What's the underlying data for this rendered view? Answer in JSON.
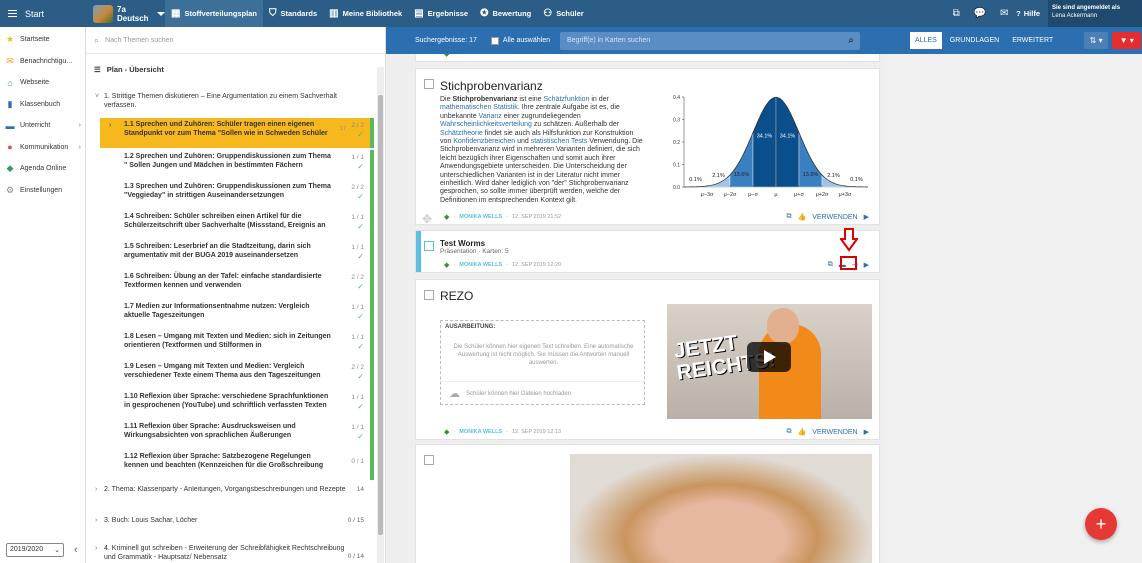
{
  "topbar": {
    "start_label": "Start",
    "class_name": "7a",
    "class_subject": "Deutsch",
    "nav": [
      {
        "label": "Stoffverteilungsplan",
        "icon": "calendar-icon",
        "active": true
      },
      {
        "label": "Standards",
        "icon": "shield-icon",
        "active": false
      },
      {
        "label": "Meine Bibliothek",
        "icon": "books-icon",
        "active": false
      },
      {
        "label": "Ergebnisse",
        "icon": "chart-icon",
        "active": false
      },
      {
        "label": "Bewertung",
        "icon": "rating-icon",
        "active": false
      },
      {
        "label": "Schüler",
        "icon": "students-icon",
        "active": false
      }
    ],
    "help_label": "Hilfe",
    "logged_in_label": "Sie sind angemeldet als",
    "user_name": "Lena Ackermann"
  },
  "sidebar": {
    "items": [
      {
        "label": "Startseite",
        "icon": "star-icon",
        "color": "#f6b81c"
      },
      {
        "label": "Benachrichtigu...",
        "icon": "mail-icon",
        "color": "#f0a030"
      },
      {
        "label": "Webseite",
        "icon": "home-icon",
        "color": "#2e9e5e"
      },
      {
        "label": "Klassenbuch",
        "icon": "book-icon",
        "color": "#2b6fb0"
      },
      {
        "label": "Unterricht",
        "icon": "folder-icon",
        "color": "#2b6fb0"
      },
      {
        "label": "Kommunikation",
        "icon": "chat-icon",
        "color": "#d9534f"
      },
      {
        "label": "Agenda Online",
        "icon": "agenda-icon",
        "color": "#2e9e5e"
      },
      {
        "label": "Einstellungen",
        "icon": "gear-icon",
        "color": "#888888"
      }
    ],
    "year": "2019/2020"
  },
  "themes": {
    "search_placeholder": "Nach Themen suchen",
    "plan_title": "Plan - Übersicht",
    "topic1": "1. Strittige Themen diskutieren – Eine Argumentation zu einem Sachverhalt verfassen.",
    "subs": [
      {
        "label": "1.1  Sprechen und Zuhören: Schüler tragen einen eigenen Standpunkt vor zum Thema \"Sollen wie in Schweden Schüler",
        "count": "2 / 2",
        "extra": "17"
      },
      {
        "label": "1.2  Sprechen und Zuhören: Gruppendiskussionen zum Thema \" Sollen Jungen und Mädchen in bestimmten Fächern",
        "count": "1 / 1"
      },
      {
        "label": "1.3  Sprechen und Zuhören: Gruppendiskussionen zum Thema \"Veggieday\" in strittigen Auseinandersetzungen",
        "count": "2 / 2"
      },
      {
        "label": "1.4  Schreiben: Schüler schreiben einen Artikel für die Schülerzeitschrift über Sachverhalte (Missstand, Ereignis an",
        "count": "1 / 1"
      },
      {
        "label": "1.5  Schreiben: Leserbrief an die Stadtzeitung, darin sich argumentativ mit der BUGA 2019 auseinandersetzen",
        "count": "1 / 1"
      },
      {
        "label": "1.6  Schreiben: Übung an der Tafel: einfache standardisierte Textformen kennen und verwenden",
        "count": "2 / 2"
      },
      {
        "label": "1.7  Medien zur Informationsentnahme nutzen: Vergleich aktuelle Tageszeitungen",
        "count": "1 / 1"
      },
      {
        "label": "1.8  Lesen – Umgang mit Texten und Medien: sich in Zeitungen orientieren (Textformen und Stilformen in",
        "count": "1 / 1"
      },
      {
        "label": "1.9  Lesen – Umgang mit Texten und Medien: Vergleich verschiedener Texte einem Thema aus den Tageszeitungen",
        "count": "2 / 2"
      },
      {
        "label": "1.10  Reflexion über Sprache: verschiedene Sprachfunktionen in gesprochenen (YouTube) und schriftlich verfassten Texten",
        "count": "1 / 1"
      },
      {
        "label": "1.11  Reflexion über Sprache: Ausdrucksweisen und Wirkungsabsichten von sprachlichen Äußerungen",
        "count": "1 / 1"
      },
      {
        "label": "1.12  Reflexion über Sprache: Satzbezogene Regelungen kennen und beachten (Kennzeichen für die Großschreibung",
        "count": "0 / 1"
      }
    ],
    "topic2": "2. Thema: Klassenparty - Anleitungen, Vorgangsbeschreibungen und Rezepte",
    "topic2_count": "14",
    "topic3": "3. Buch: Louis Sachar, Löcher",
    "topic3_count": "0 / 15",
    "topic4": "4. Kriminell gut schreiben - Erweiterung der Schreibfähigkeit Rechtschreibung und Grammatik - Hauptsatz/ Nebensatz",
    "topic4_count": "0 / 14"
  },
  "results": {
    "count_label": "Suchergebnisse: 17",
    "select_all": "Alle auswählen",
    "search_placeholder": "Begriff(e) in Karten suchen",
    "filters": [
      "ALLES",
      "GRUNDLAGEN",
      "ERWEITERT"
    ]
  },
  "cards": {
    "c1": {
      "title": "Stichprobenvarianz",
      "text_a": "Die ",
      "text_b": "Stichprobenvarianz",
      "text_c": " ist eine ",
      "text_d": "Schätzfunktion",
      "text_e": " in der ",
      "text_f": "mathematischen Statistik",
      "text_g": ". Ihre zentrale Aufgabe ist es, die unbekannte ",
      "text_h": "Varianz",
      "text_i": " einer zugrundeliegenden ",
      "text_j": "Wahrscheinlichkeitsverteilung",
      "text_k": " zu schätzen. Außerhalb der ",
      "text_l": "Schätztheorie",
      "text_m": " findet sie auch als Hilfsfunktion zur Konstruktion von ",
      "text_n": "Konfidenzbereichen",
      "text_o": " und ",
      "text_p": "statistischen Tests",
      "text_q": " Verwendung. Die Stichprobenvarianz wird in mehreren Varianten definiert, die sich leicht bezüglich ihrer Eigenschaften und somit auch ihrer Anwendungsgebiete unterscheiden. Die Unterscheidung der unterschiedlichen Varianten ist in der Literatur nicht immer einheitlich. Wird daher lediglich von \"der\" Stichprobenvarianz gesprochen, so sollte immer überprüft werden, welche der Definitionen im entsprechenden Kontext gilt.",
      "author": "MONIKA WELLS",
      "date": "12. SEP 2019 21:52",
      "use_label": "VERWENDEN"
    },
    "c2": {
      "title": "Test Worms",
      "subtitle": "Präsentation · Karten: 5",
      "author": "MONIKA WELLS",
      "date": "12. SEP 2019 12:20"
    },
    "c3": {
      "title": "REZO",
      "work_label": "AUSARBEITUNG:",
      "work_text": "Die Schüler können hier eigenen Text schreiben. Eine automatische Auswertung ist nicht möglich. Sie müssen die Antworten manuell auswerten.",
      "upload_text": "Schüler können hier Dateien hochladen",
      "video_text_1": "JETZT",
      "video_text_2": "REICHTS!",
      "author": "MONIKA WELLS",
      "date": "12. SEP 2019 12:13",
      "use_label": "VERWENDEN"
    }
  },
  "chart_data": {
    "type": "area",
    "categories": [
      "μ−3σ",
      "μ−2σ",
      "μ−σ",
      "μ",
      "μ+σ",
      "μ+2σ",
      "μ+3σ"
    ],
    "segments": [
      {
        "label": "0.1%",
        "from": -4,
        "to": -3
      },
      {
        "label": "2.1%",
        "from": -3,
        "to": -2
      },
      {
        "label": "13.6%",
        "from": -2,
        "to": -1
      },
      {
        "label": "34.1%",
        "from": -1,
        "to": 0
      },
      {
        "label": "34.1%",
        "from": 0,
        "to": 1
      },
      {
        "label": "13.6%",
        "from": 1,
        "to": 2
      },
      {
        "label": "2.1%",
        "from": 2,
        "to": 3
      },
      {
        "label": "0.1%",
        "from": 3,
        "to": 4
      }
    ],
    "y_ticks": [
      "0.0",
      "0.1",
      "0.2",
      "0.3",
      "0.4"
    ],
    "ylim": [
      0,
      0.4
    ],
    "xlim": [
      -4,
      4
    ],
    "colors": {
      "dark": "#0a4f8c",
      "mid": "#3a7fc0",
      "light": "#9ec5e8"
    }
  },
  "add_button_label": "+"
}
